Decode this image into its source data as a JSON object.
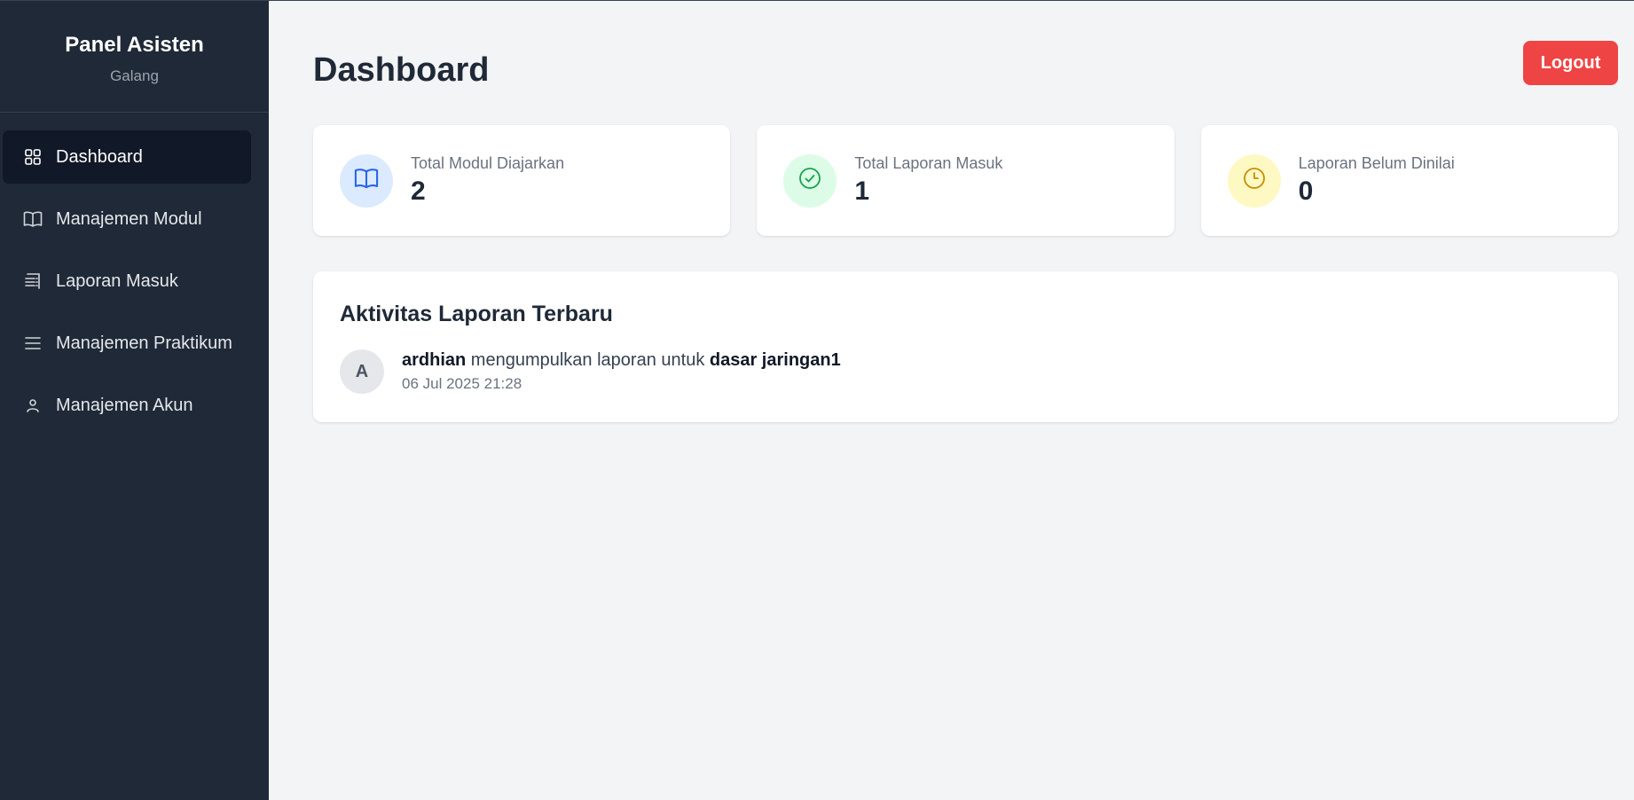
{
  "sidebar": {
    "title": "Panel Asisten",
    "user": "Galang",
    "items": [
      {
        "label": "Dashboard",
        "icon": "grid-icon",
        "active": true
      },
      {
        "label": "Manajemen Modul",
        "icon": "book-icon"
      },
      {
        "label": "Laporan Masuk",
        "icon": "report-list-icon"
      },
      {
        "label": "Manajemen Praktikum",
        "icon": "menu-lines-icon"
      },
      {
        "label": "Manajemen Akun",
        "icon": "user-icon"
      }
    ]
  },
  "header": {
    "title": "Dashboard",
    "logout_label": "Logout"
  },
  "stats": [
    {
      "label": "Total Modul Diajarkan",
      "value": "2",
      "icon": "book-icon",
      "color": "#2563eb",
      "bg": "#dbeafe"
    },
    {
      "label": "Total Laporan Masuk",
      "value": "1",
      "icon": "check-circle-icon",
      "color": "#16a34a",
      "bg": "#dcfce7"
    },
    {
      "label": "Laporan Belum Dinilai",
      "value": "0",
      "icon": "clock-icon",
      "color": "#ca8a04",
      "bg": "#fef9c3"
    }
  ],
  "activity": {
    "title": "Aktivitas Laporan Terbaru",
    "items": [
      {
        "avatar": "A",
        "user": "ardhian",
        "text": " mengumpulkan laporan untuk ",
        "target": "dasar jaringan1",
        "time": "06 Jul 2025 21:28"
      }
    ]
  },
  "colors": {
    "sidebar_bg": "#1f2937",
    "active_bg": "#111827",
    "logout": "#ef4444"
  }
}
